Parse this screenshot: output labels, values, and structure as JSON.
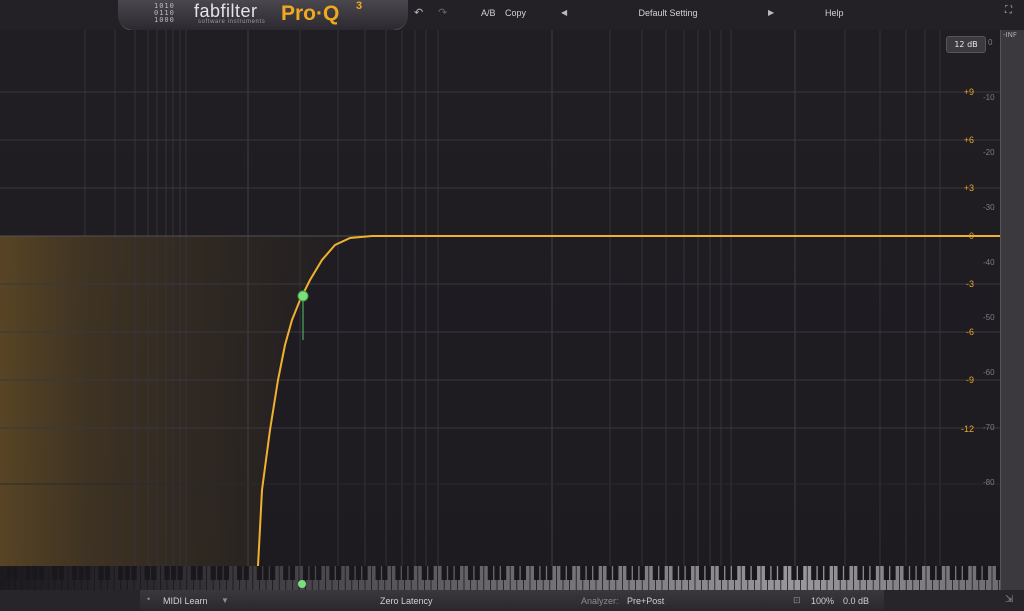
{
  "header": {
    "brand": "fabfilter",
    "brand_sub": "software instruments",
    "product": "Pro·Q",
    "product_version": "3",
    "undo_icon": "undo-icon",
    "redo_icon": "redo-icon",
    "ab_label": "A/B",
    "copy_label": "Copy",
    "preset_prev_icon": "triangle-left-icon",
    "preset_name": "Default Setting",
    "preset_next_icon": "triangle-right-icon",
    "help_label": "Help",
    "fullscreen_icon": "fullscreen-icon"
  },
  "display": {
    "range_button": "12 dB",
    "eq_scale": [
      "+9",
      "+6",
      "+3",
      "0",
      "-3",
      "-6",
      "-9",
      "-12"
    ],
    "analyzer_scale": [
      "0",
      "-10",
      "-20",
      "-30",
      "-40",
      "-50",
      "-60",
      "-70",
      "-80"
    ],
    "meter_top_label": "-INF",
    "curve_color": "#f0b030",
    "node_color": "#7be07b"
  },
  "footer": {
    "midi_learn": "MIDI Learn",
    "latency": "Zero Latency",
    "analyzer_label": "Analyzer:",
    "analyzer_value": "Pre+Post",
    "zoom": "100%",
    "output_gain": "0.0 dB"
  }
}
